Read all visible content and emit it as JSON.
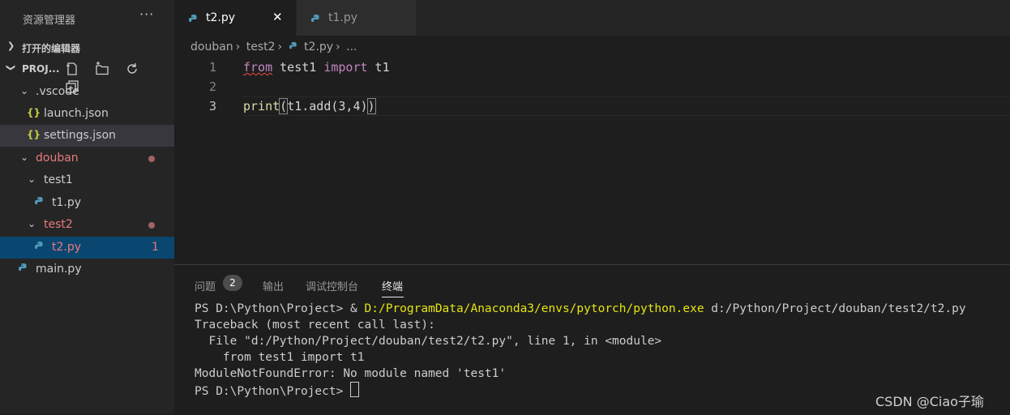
{
  "explorer": {
    "title": "资源管理器",
    "more": "···",
    "open_editors": "打开的编辑器",
    "project_label": "PROJ...",
    "tree": [
      {
        "label": ".vscode",
        "kind": "folder",
        "open": true
      },
      {
        "label": "launch.json",
        "kind": "json"
      },
      {
        "label": "settings.json",
        "kind": "json"
      },
      {
        "label": "douban",
        "kind": "folder",
        "open": true
      },
      {
        "label": "test1",
        "kind": "folder",
        "open": true
      },
      {
        "label": "t1.py",
        "kind": "py"
      },
      {
        "label": "test2",
        "kind": "folder",
        "open": true
      },
      {
        "label": "t2.py",
        "kind": "py",
        "problems": "1"
      },
      {
        "label": "main.py",
        "kind": "py"
      }
    ]
  },
  "tabs": [
    {
      "label": "t2.py",
      "active": true,
      "close": "✕"
    },
    {
      "label": "t1.py",
      "active": false
    }
  ],
  "breadcrumb": [
    "douban",
    "test2",
    "t2.py",
    "..."
  ],
  "editor": {
    "lines": [
      {
        "num": "1",
        "kw1": "from",
        "mod": " test1 ",
        "kw2": "import",
        "rest": " t1"
      },
      {
        "num": "2"
      },
      {
        "num": "3",
        "fn": "print",
        "open": "(",
        "mid": "t1.add(3,4)",
        "close": ")"
      }
    ]
  },
  "panel": {
    "tabs": [
      "问题",
      "输出",
      "调试控制台",
      "终端"
    ],
    "problems_count": "2",
    "terminal": {
      "line1_prompt": "PS D:\\Python\\Project> & ",
      "line1_exe": "D:/ProgramData/Anaconda3/envs/pytorch/python.exe",
      "line1_arg": " d:/Python/Project/douban/test2/t2.py",
      "line2": "Traceback (most recent call last):",
      "line3": "  File \"d:/Python/Project/douban/test2/t2.py\", line 1, in <module>",
      "line4": "    from test1 import t1",
      "line5": "ModuleNotFoundError: No module named 'test1'",
      "line6": "PS D:\\Python\\Project> "
    }
  },
  "watermark": "CSDN @Ciao子瑜",
  "colors": {
    "keyword": "#c586c0",
    "function": "#dcdcaa",
    "modified": "#e87b7b",
    "py_icon": "#519aba",
    "json_icon": "#cbcb41",
    "exe_path": "#e5e510"
  }
}
